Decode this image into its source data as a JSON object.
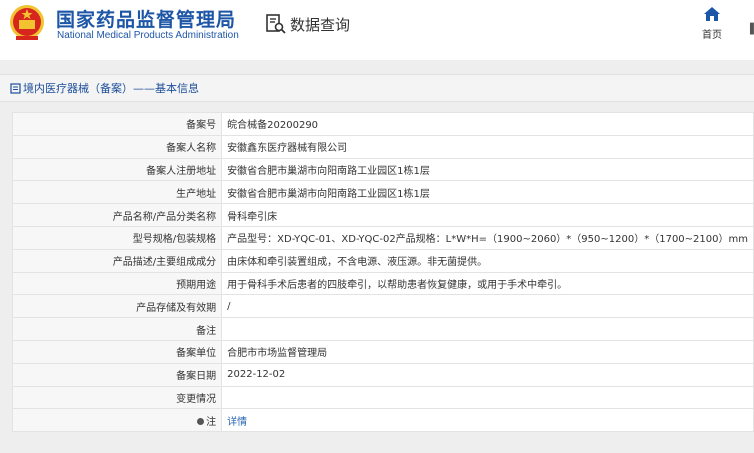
{
  "header": {
    "brand_cn": "国家药品监督管理局",
    "brand_en": "National Medical Products Administration",
    "query_title": "数据查询",
    "home_label": "首页",
    "edge_text": "▌",
    "icons": {
      "emblem": "national-emblem-icon",
      "query": "search-document-icon",
      "home": "home-icon"
    }
  },
  "breadcrumb": {
    "text": "境内医疗器械（备案）——基本信息",
    "icon": "document-icon"
  },
  "record": {
    "rows": [
      {
        "label": "备案号",
        "value": "皖合械备20200290"
      },
      {
        "label": "备案人名称",
        "value": "安徽鑫东医疗器械有限公司"
      },
      {
        "label": "备案人注册地址",
        "value": "安徽省合肥市巢湖市向阳南路工业园区1栋1层"
      },
      {
        "label": "生产地址",
        "value": "安徽省合肥市巢湖市向阳南路工业园区1栋1层"
      },
      {
        "label": "产品名称/产品分类名称",
        "value": "骨科牵引床"
      },
      {
        "label": "型号规格/包装规格",
        "value": "产品型号：XD-YQC-01、XD-YQC-02产品规格：L*W*H=（1900~2060）*（950~1200）*（1700~2100）mm"
      },
      {
        "label": "产品描述/主要组成成分",
        "value": "由床体和牵引装置组成，不含电源、液压源。非无菌提供。"
      },
      {
        "label": "预期用途",
        "value": "用于骨科手术后患者的四肢牵引，以帮助患者恢复健康，或用于手术中牵引。"
      },
      {
        "label": "产品存储及有效期",
        "value": "/"
      },
      {
        "label": "备注",
        "value": ""
      },
      {
        "label": "备案单位",
        "value": "合肥市市场监督管理局"
      },
      {
        "label": "备案日期",
        "value": "2022-12-02"
      },
      {
        "label": "变更情况",
        "value": ""
      },
      {
        "label": "注",
        "value": "详情"
      }
    ]
  },
  "colors": {
    "brand_blue": "#1d56a6",
    "link_blue": "#2766b5",
    "emblem_red": "#d7261e",
    "emblem_gold": "#f2c230"
  }
}
